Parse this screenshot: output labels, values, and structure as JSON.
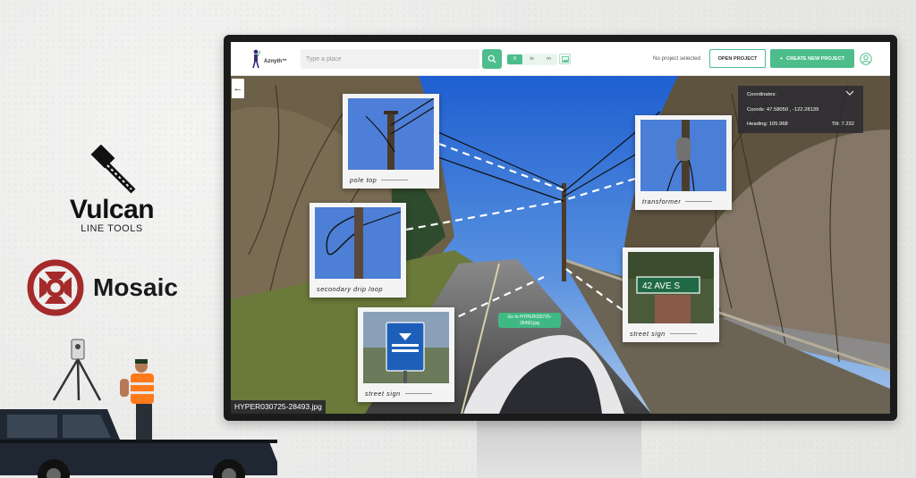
{
  "brand": {
    "vulcan_name": "Vulcan",
    "vulcan_sub": "LINE TOOLS",
    "mosaic_name": "Mosaic",
    "mosaic_color": "#a52a2a"
  },
  "app": {
    "logo_text": "Aznyth™",
    "search_placeholder": "Type a place",
    "units": [
      "ft",
      "in",
      "m"
    ],
    "active_unit": "ft",
    "project_status": "No project selected",
    "open_project": "OPEN PROJECT",
    "create_project": "CREATE NEW PROJECT",
    "accent": "#4dbd8c"
  },
  "coordinates": {
    "title": "Coordinates:",
    "coords": "Coords: 47.58050 , -122.28139",
    "heading": "Heading: 105.968",
    "tilt": "Tilt: 7.232"
  },
  "callouts": {
    "pole_top": "pole top",
    "transformer": "transformer",
    "drip_loop": "secondary drip loop",
    "street_sign_right": "street sign",
    "street_sign_left": "street sign"
  },
  "goto_label": "Go to HYPER030725-28493.jpg",
  "filename": "HYPER030725-28493.jpg"
}
